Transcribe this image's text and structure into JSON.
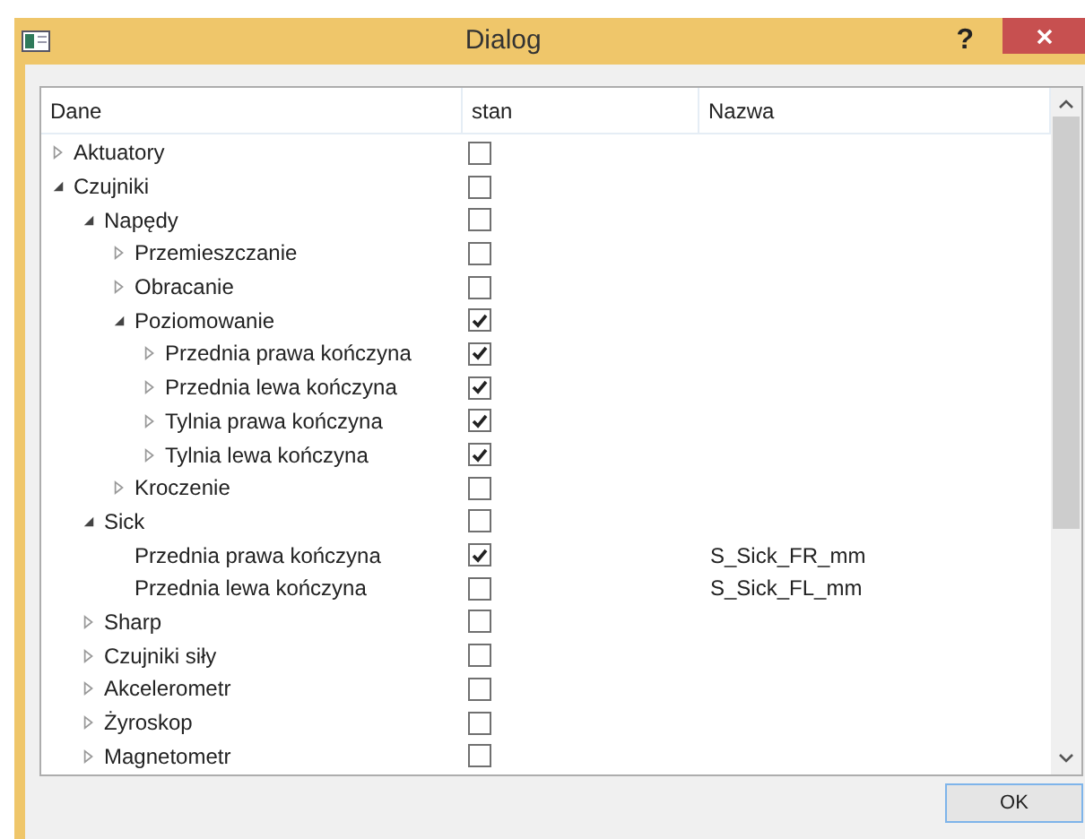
{
  "window": {
    "title": "Dialog",
    "help": "?"
  },
  "table": {
    "columns": [
      "Dane",
      "stan",
      "Nazwa"
    ],
    "rows": [
      {
        "label": "Aktuatory",
        "kind": "branch",
        "expanded": false,
        "checked": false
      },
      {
        "label": "Czujniki",
        "kind": "branch",
        "expanded": true,
        "checked": false,
        "children": [
          {
            "label": "Napędy",
            "kind": "branch",
            "expanded": true,
            "checked": false,
            "children": [
              {
                "label": "Przemieszczanie",
                "kind": "branch",
                "expanded": false,
                "checked": false
              },
              {
                "label": "Obracanie",
                "kind": "branch",
                "expanded": false,
                "checked": false
              },
              {
                "label": "Poziomowanie",
                "kind": "branch",
                "expanded": true,
                "checked": true,
                "children": [
                  {
                    "label": "Przednia prawa kończyna",
                    "kind": "branch",
                    "expanded": false,
                    "checked": true
                  },
                  {
                    "label": "Przednia lewa kończyna",
                    "kind": "branch",
                    "expanded": false,
                    "checked": true
                  },
                  {
                    "label": "Tylnia prawa kończyna",
                    "kind": "branch",
                    "expanded": false,
                    "checked": true
                  },
                  {
                    "label": "Tylnia lewa kończyna",
                    "kind": "branch",
                    "expanded": false,
                    "checked": true
                  }
                ]
              },
              {
                "label": "Kroczenie",
                "kind": "branch",
                "expanded": false,
                "checked": false
              }
            ]
          },
          {
            "label": "Sick",
            "kind": "branch",
            "expanded": true,
            "checked": false,
            "children": [
              {
                "label": "Przednia prawa kończyna",
                "kind": "leaf",
                "checked": true,
                "name": "S_Sick_FR_mm"
              },
              {
                "label": "Przednia lewa kończyna",
                "kind": "leaf",
                "checked": false,
                "name": "S_Sick_FL_mm"
              }
            ]
          },
          {
            "label": "Sharp",
            "kind": "branch",
            "expanded": false,
            "checked": false
          },
          {
            "label": "Czujniki siły",
            "kind": "branch",
            "expanded": false,
            "checked": false
          },
          {
            "label": "Akcelerometr",
            "kind": "branch",
            "expanded": false,
            "checked": false
          },
          {
            "label": "Żyroskop",
            "kind": "branch",
            "expanded": false,
            "checked": false
          },
          {
            "label": "Magnetometr",
            "kind": "branch",
            "expanded": false,
            "checked": false
          }
        ]
      }
    ]
  },
  "buttons": [
    "OK"
  ]
}
